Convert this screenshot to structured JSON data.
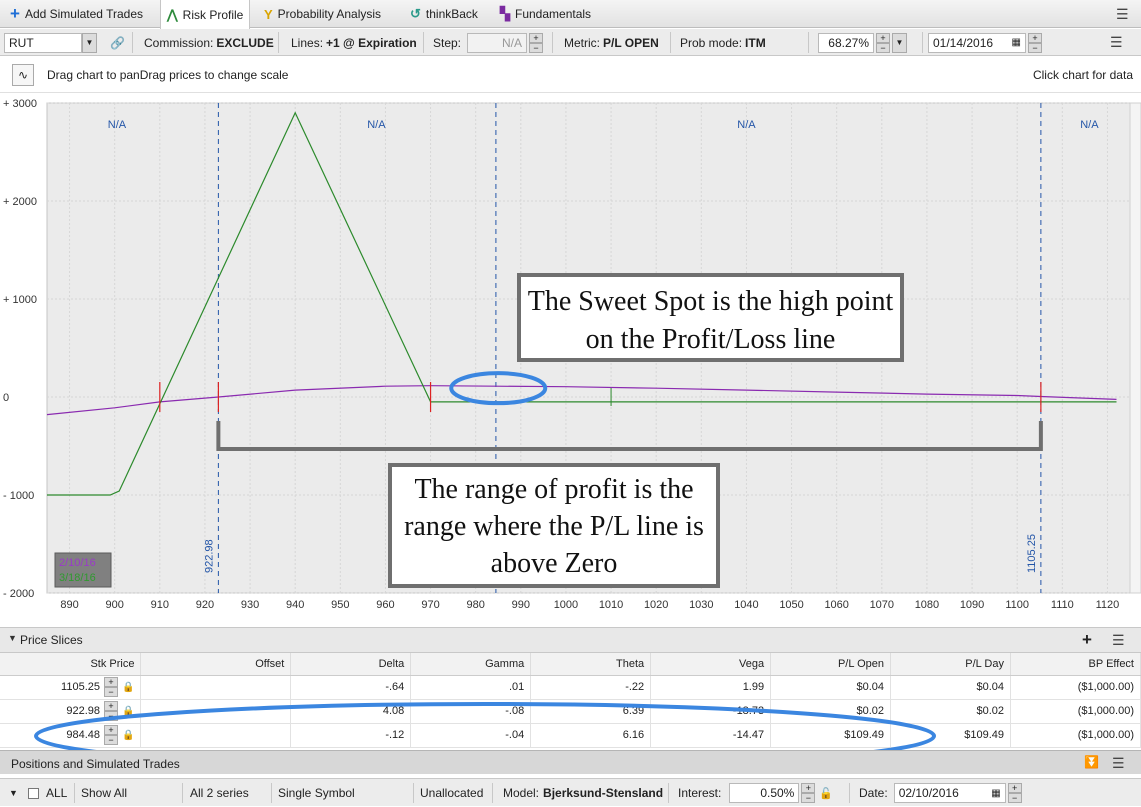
{
  "tabs": [
    {
      "label": "Add Simulated Trades",
      "icon": "plus-icon",
      "color": "#1f6fd6",
      "active": false
    },
    {
      "label": "Risk Profile",
      "icon": "risk-profile-icon",
      "color": "#2e8a3c",
      "active": true
    },
    {
      "label": "Probability Analysis",
      "icon": "probability-icon",
      "color": "#d9a400",
      "active": false
    },
    {
      "label": "thinkBack",
      "icon": "history-icon",
      "color": "#2a9a8a",
      "active": false
    },
    {
      "label": "Fundamentals",
      "icon": "fundamentals-icon",
      "color": "#7a2aa0",
      "active": false
    }
  ],
  "toolbar": {
    "symbol": "RUT",
    "commission_label": "Commission:",
    "commission_value": "EXCLUDE",
    "lines_label": "Lines:",
    "lines_value": "+1 @ Expiration",
    "step_label": "Step:",
    "step_value": "N/A",
    "metric_label": "Metric:",
    "metric_value": "P/L OPEN",
    "prob_label": "Prob mode:",
    "prob_value": "ITM",
    "percent": "68.27%",
    "date": "01/14/2016"
  },
  "hint": {
    "left": "Drag chart to panDrag prices to change scale",
    "right": "Click chart for data"
  },
  "chart_data": {
    "type": "line",
    "x_ticks": [
      890,
      900,
      910,
      920,
      930,
      940,
      950,
      960,
      970,
      980,
      990,
      1000,
      1010,
      1020,
      1030,
      1040,
      1050,
      1060,
      1070,
      1080,
      1090,
      1100,
      1110,
      1120
    ],
    "y_ticks": [
      "+ 3000",
      "+ 2000",
      "+ 1000",
      "0",
      "- 1000",
      "- 2000"
    ],
    "xlim": [
      885,
      1125
    ],
    "ylim": [
      -2000,
      3000
    ],
    "zone_labels": [
      "N/A",
      "N/A",
      "N/A",
      "N/A"
    ],
    "vlines": [
      {
        "x": 922.98,
        "label": "922.98"
      },
      {
        "x": 1105.25,
        "label": "1105.25"
      }
    ],
    "legend": [
      "2/10/16",
      "3/18/16"
    ],
    "series": [
      {
        "name": "2/10/16",
        "color": "#8a2ab0",
        "points": [
          [
            885,
            -180
          ],
          [
            900,
            -110
          ],
          [
            910,
            -50
          ],
          [
            922.98,
            0
          ],
          [
            940,
            70
          ],
          [
            960,
            110
          ],
          [
            970,
            115
          ],
          [
            984.48,
            110
          ],
          [
            1000,
            105
          ],
          [
            1020,
            90
          ],
          [
            1040,
            70
          ],
          [
            1060,
            50
          ],
          [
            1080,
            30
          ],
          [
            1100,
            15
          ],
          [
            1105.25,
            5
          ],
          [
            1122,
            -25
          ]
        ]
      },
      {
        "name": "3/18/16",
        "color": "#2c8a2c",
        "points": [
          [
            885,
            -1000
          ],
          [
            899,
            -1000
          ],
          [
            901,
            -960
          ],
          [
            940,
            2900
          ],
          [
            970,
            -50
          ],
          [
            1122,
            -50
          ]
        ]
      }
    ]
  },
  "callouts": {
    "sweet": "The Sweet Spot is the high point on the Profit/Loss line",
    "range": "The range of profit is the range where the P/L line is above Zero"
  },
  "slices": {
    "title": "Price Slices",
    "columns": [
      "Stk Price",
      "Offset",
      "Delta",
      "Gamma",
      "Theta",
      "Vega",
      "P/L Open",
      "P/L Day",
      "BP Effect"
    ],
    "rows": [
      {
        "stk": "1105.25",
        "offset": "",
        "delta": "-.64",
        "gamma": ".01",
        "theta": "-.22",
        "vega": "1.99",
        "plopen": "$0.04",
        "plday": "$0.04",
        "bp": "($1,000.00)"
      },
      {
        "stk": "922.98",
        "offset": "",
        "delta": "4.08",
        "gamma": "-.08",
        "theta": "6.39",
        "vega": "-18.73",
        "plopen": "$0.02",
        "plday": "$0.02",
        "bp": "($1,000.00)"
      },
      {
        "stk": "984.48",
        "offset": "",
        "delta": "-.12",
        "gamma": "-.04",
        "theta": "6.16",
        "vega": "-14.47",
        "plopen": "$109.49",
        "plday": "$109.49",
        "bp": "($1,000.00)"
      }
    ]
  },
  "positions": {
    "title": "Positions and Simulated Trades"
  },
  "bottom": {
    "all": "ALL",
    "show_all": "Show All",
    "series": "All 2 series",
    "single": "Single Symbol",
    "unallocated": "Unallocated",
    "model_label": "Model:",
    "model_value": "Bjerksund-Stensland",
    "interest_label": "Interest:",
    "interest_value": "0.50%",
    "date_label": "Date:",
    "date_value": "02/10/2016"
  }
}
